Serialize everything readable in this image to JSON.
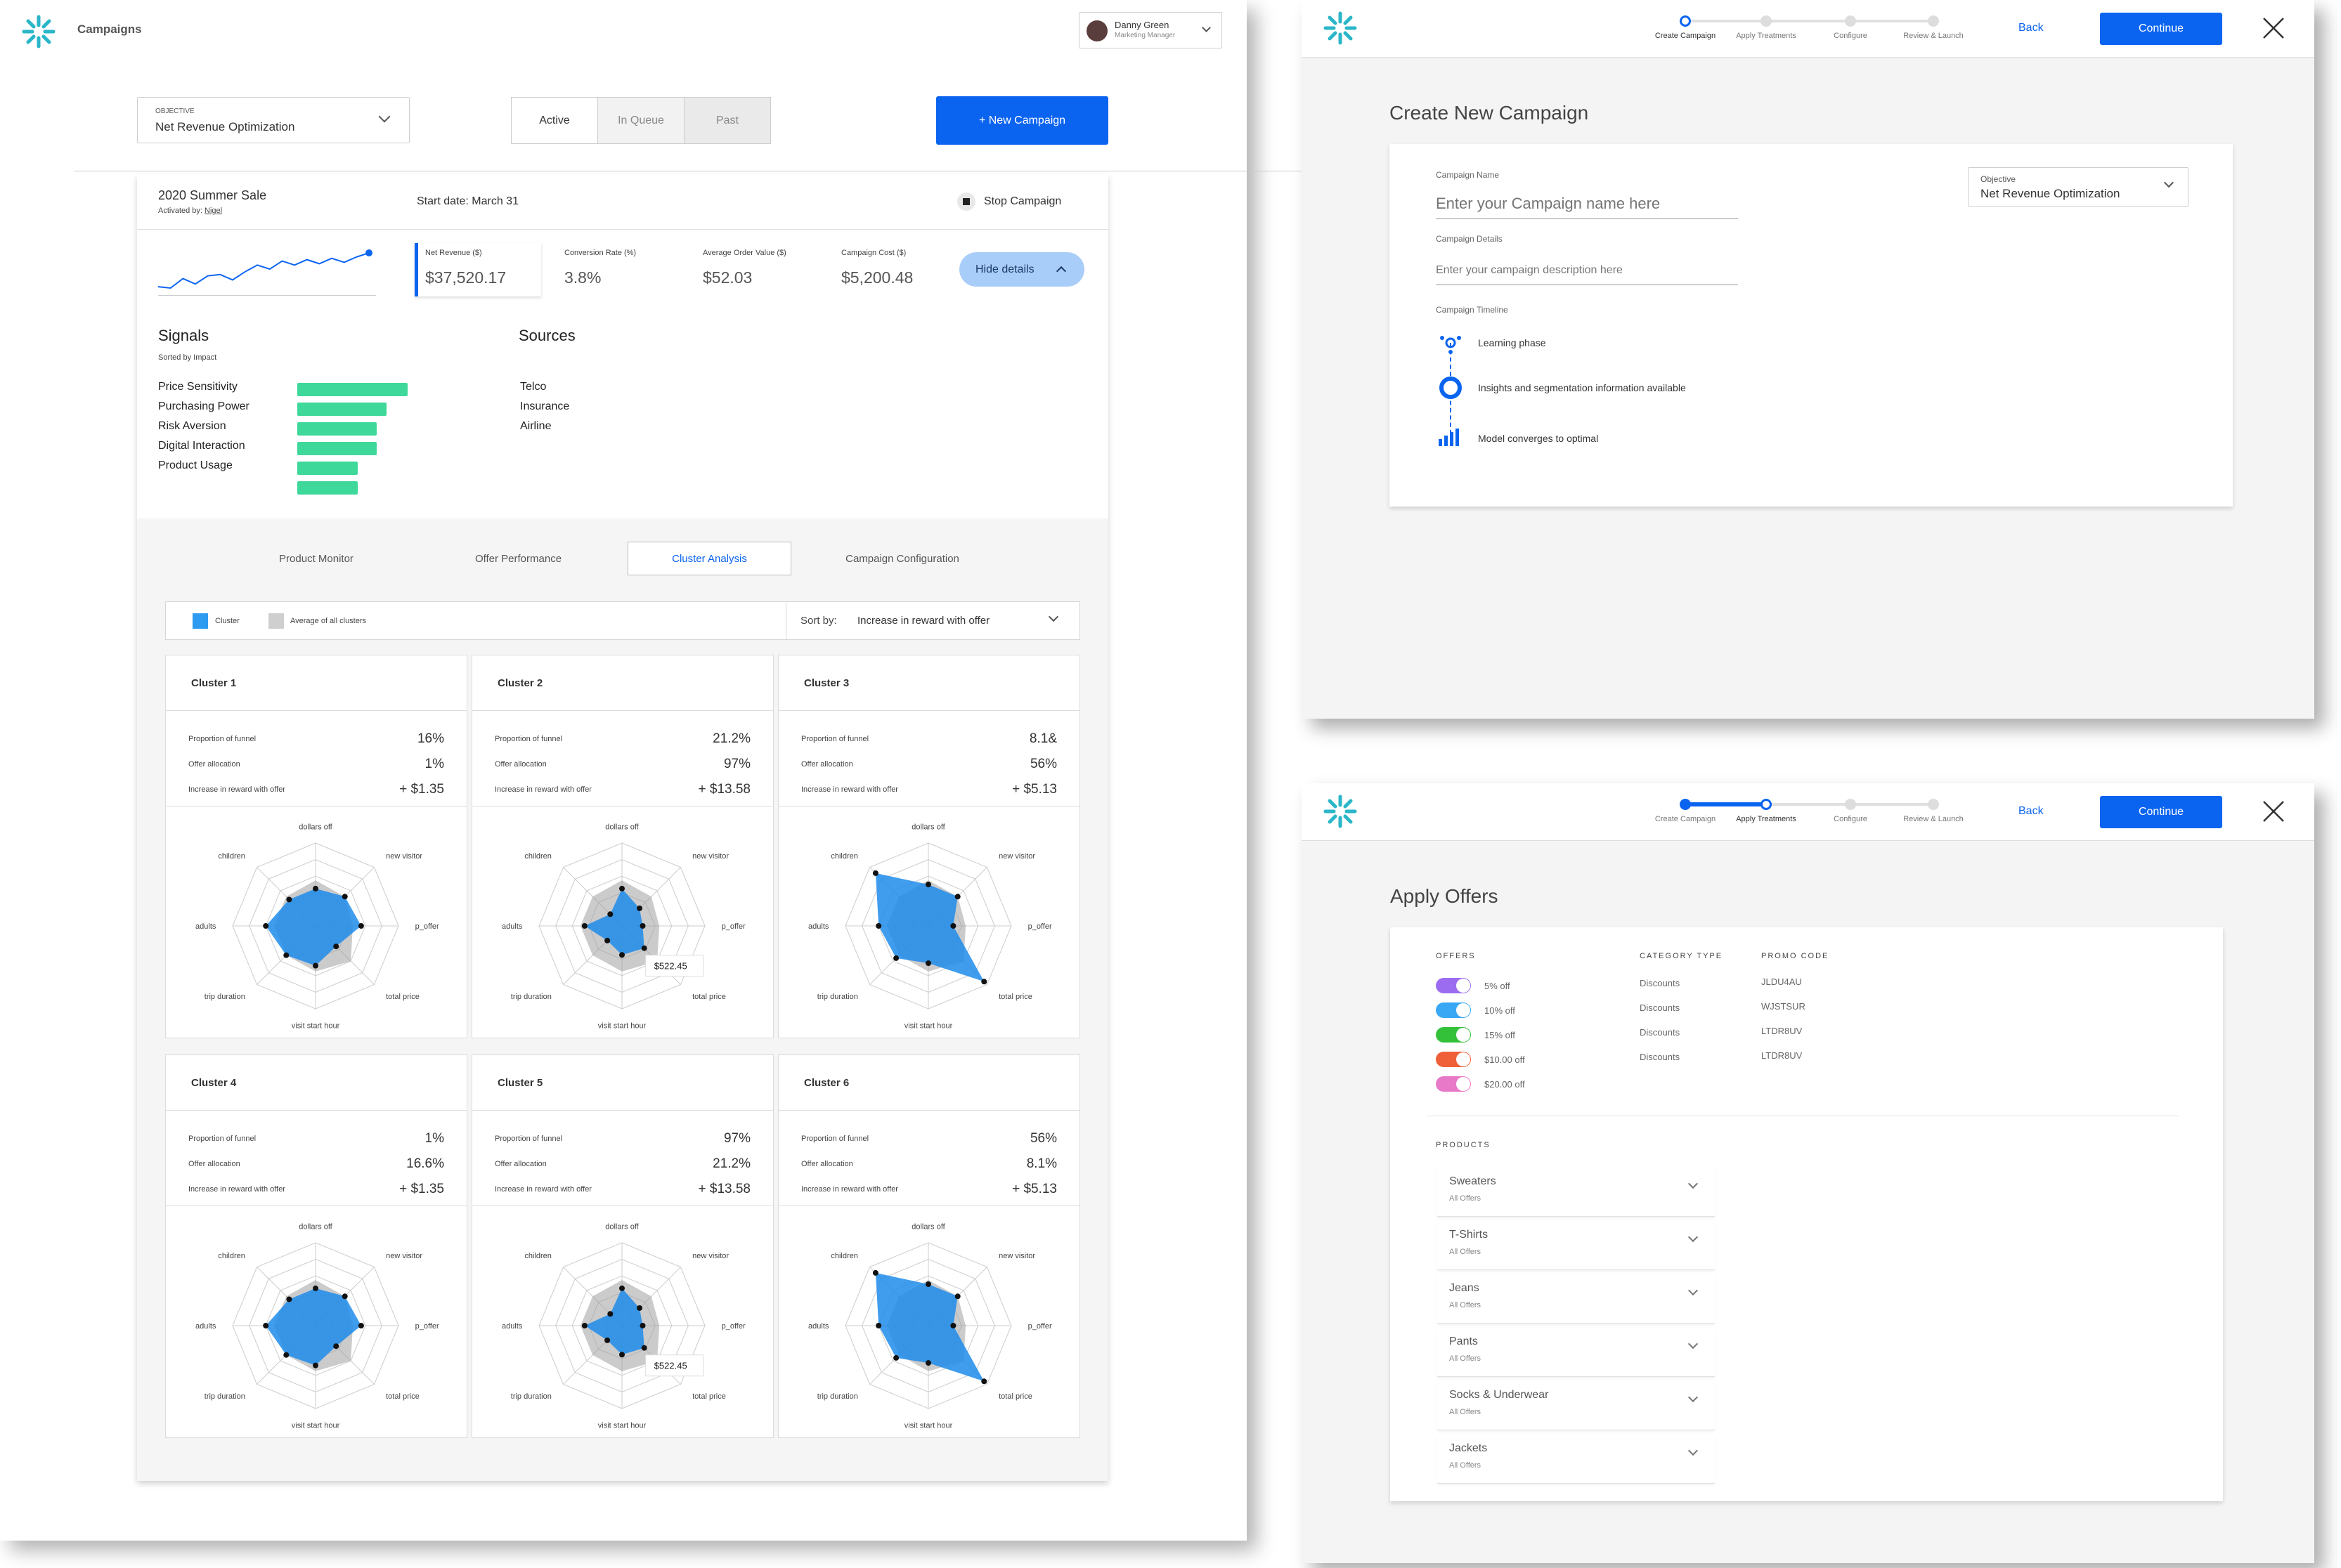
{
  "app": {
    "title": "Campaigns",
    "user_name": "Danny Green",
    "user_role": "Marketing Manager"
  },
  "filters": {
    "objective_label": "OBJECTIVE",
    "objective_value": "Net Revenue Optimization",
    "tabs": [
      "Active",
      "In Queue",
      "Past"
    ],
    "new_campaign": "+ New Campaign"
  },
  "campaign": {
    "name": "2020 Summer Sale",
    "activated_prefix": "Activated by: ",
    "activated_by": "Nigel",
    "start": "Start date: March 31",
    "stop": "Stop Campaign",
    "hide": "Hide details",
    "metrics": [
      {
        "label": "Net Revenue ($)",
        "value": "$37,520.17"
      },
      {
        "label": "Conversion Rate (%)",
        "value": "3.8%"
      },
      {
        "label": "Average Order Value ($)",
        "value": "$52.03"
      },
      {
        "label": "Campaign Cost ($)",
        "value": "$5,200.48"
      }
    ],
    "sparkline": [
      30,
      28,
      42,
      34,
      46,
      48,
      40,
      52,
      62,
      56,
      68,
      62,
      70,
      64,
      72,
      66,
      74,
      80
    ],
    "signals_title": "Signals",
    "signals_sub": "Sorted by Impact",
    "signals": [
      {
        "name": "Price Sensitivity",
        "impact": 1.0
      },
      {
        "name": "Purchasing Power",
        "impact": 0.81
      },
      {
        "name": "Risk Aversion",
        "impact": 0.72
      },
      {
        "name": "Digital Interaction",
        "impact": 0.72
      },
      {
        "name": "Product Usage",
        "impact": 0.55
      }
    ],
    "extra_bar_impact": 0.55,
    "sources_title": "Sources",
    "sources": [
      "Telco",
      "Insurance",
      "Airline"
    ]
  },
  "analysis": {
    "tabs": [
      "Product Monitor",
      "Offer Performance",
      "Cluster Analysis",
      "Campaign Configuration"
    ],
    "active_tab": 2,
    "legend_cluster": "Cluster",
    "legend_avg": "Average of all clusters",
    "sort_label": "Sort by:",
    "sort_value": "Increase in reward with offer",
    "axes": [
      "dollars off",
      "new visitor",
      "p_offer",
      "total price",
      "visit start hour",
      "trip duration",
      "adults",
      "children"
    ],
    "avg_profile": [
      0.55,
      0.5,
      0.45,
      0.6,
      0.55,
      0.5,
      0.5,
      0.5
    ],
    "row_labels": [
      "Proportion of funnel",
      "Offer allocation",
      "Increase in reward with offer"
    ],
    "clusters": [
      {
        "name": "Cluster 1",
        "values": [
          "16%",
          "1%",
          "+ $1.35"
        ],
        "profile": [
          0.45,
          0.5,
          0.55,
          0.35,
          0.48,
          0.5,
          0.6,
          0.45
        ],
        "tooltip": ""
      },
      {
        "name": "Cluster 2",
        "values": [
          "21.2%",
          "97%",
          "+ $13.58"
        ],
        "profile": [
          0.45,
          0.3,
          0.25,
          0.38,
          0.35,
          0.25,
          0.45,
          0.2
        ],
        "tooltip": "$522.45"
      },
      {
        "name": "Cluster 3",
        "values": [
          "8.1&",
          "56%",
          "+ $5.13"
        ],
        "profile": [
          0.5,
          0.5,
          0.3,
          0.95,
          0.45,
          0.55,
          0.6,
          0.9
        ],
        "tooltip": ""
      },
      {
        "name": "Cluster 4",
        "values": [
          "1%",
          "16.6%",
          "+ $1.35"
        ],
        "profile": [
          0.45,
          0.5,
          0.55,
          0.35,
          0.48,
          0.5,
          0.6,
          0.45
        ],
        "tooltip": ""
      },
      {
        "name": "Cluster 5",
        "values": [
          "97%",
          "21.2%",
          "+ $13.58"
        ],
        "profile": [
          0.45,
          0.3,
          0.25,
          0.38,
          0.35,
          0.25,
          0.45,
          0.2
        ],
        "tooltip": "$522.45"
      },
      {
        "name": "Cluster 6",
        "values": [
          "56%",
          "8.1%",
          "+ $5.13"
        ],
        "profile": [
          0.5,
          0.5,
          0.3,
          0.95,
          0.45,
          0.55,
          0.6,
          0.9
        ],
        "tooltip": ""
      }
    ]
  },
  "wizard": {
    "steps": [
      "Create Campaign",
      "Apply Treatments",
      "Configure",
      "Review & Launch"
    ],
    "back": "Back",
    "continue": "Continue"
  },
  "create": {
    "title": "Create New Campaign",
    "name_label": "Campaign Name",
    "name_placeholder": "Enter your Campaign name here",
    "details_label": "Campaign Details",
    "details_placeholder": "Enter your campaign description here",
    "objective_label": "Objective",
    "objective_value": "Net Revenue Optimization",
    "timeline_label": "Campaign Timeline",
    "timeline": [
      "Learning phase",
      "Insights and segmentation information available",
      "Model converges to optimal"
    ]
  },
  "offers": {
    "title": "Apply Offers",
    "col_offers": "OFFERS",
    "col_category": "CATEGORY TYPE",
    "col_promo": "PROMO CODE",
    "items": [
      {
        "label": "5% off",
        "category": "Discounts",
        "promo": "JLDU4AU",
        "color": "#9c6cf0"
      },
      {
        "label": "10% off",
        "category": "Discounts",
        "promo": "WJSTSUR",
        "color": "#38a8f5"
      },
      {
        "label": "15% off",
        "category": "Discounts",
        "promo": "LTDR8UV",
        "color": "#34c13a"
      },
      {
        "label": "$10.00 off",
        "category": "Discounts",
        "promo": "LTDR8UV",
        "color": "#f06038"
      },
      {
        "label": "$20.00 off",
        "category": "",
        "promo": "",
        "color": "#e878c8"
      }
    ],
    "products_label": "PRODUCTS",
    "products": [
      "Sweaters",
      "T-Shirts",
      "Jeans",
      "Pants",
      "Socks & Underwear",
      "Jackets"
    ],
    "product_sub": "All Offers"
  },
  "colors": {
    "accent": "#0b64f0",
    "signal": "#3ed89a",
    "cluster": "#2e9af0",
    "avg": "#bdbdbd",
    "logo": "#2ab6c8"
  }
}
